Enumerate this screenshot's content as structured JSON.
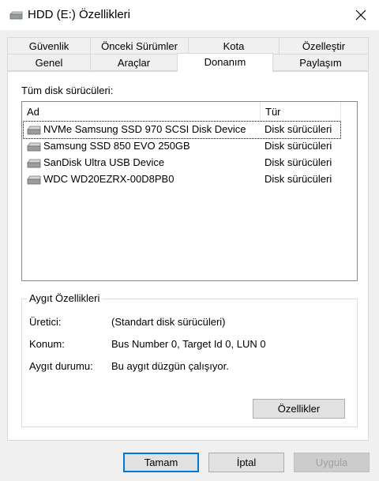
{
  "window": {
    "title": "HDD (E:) Özellikleri"
  },
  "tabs": {
    "row1": [
      "Güvenlik",
      "Önceki Sürümler",
      "Kota",
      "Özelleştir"
    ],
    "row2": [
      "Genel",
      "Araçlar",
      "Donanım",
      "Paylaşım"
    ],
    "active": "Donanım"
  },
  "drives_label": "Tüm disk sürücüleri:",
  "list": {
    "columns": [
      "Ad",
      "Tür"
    ],
    "rows": [
      {
        "name": "NVMe Samsung SSD 970 SCSI Disk Device",
        "type": "Disk sürücüleri",
        "selected": true
      },
      {
        "name": "Samsung SSD 850 EVO 250GB",
        "type": "Disk sürücüleri"
      },
      {
        "name": "SanDisk Ultra USB Device",
        "type": "Disk sürücüleri"
      },
      {
        "name": "WDC WD20EZRX-00D8PB0",
        "type": "Disk sürücüleri"
      }
    ]
  },
  "device_properties": {
    "title": "Aygıt Özellikleri",
    "manufacturer_label": "Üretici:",
    "manufacturer_value": "(Standart disk sürücüleri)",
    "location_label": "Konum:",
    "location_value": "Bus Number 0, Target Id 0, LUN 0",
    "status_label": "Aygıt durumu:",
    "status_value": "Bu aygıt düzgün çalışıyor.",
    "properties_button": "Özellikler"
  },
  "buttons": {
    "ok": "Tamam",
    "cancel": "İptal",
    "apply": "Uygula"
  }
}
